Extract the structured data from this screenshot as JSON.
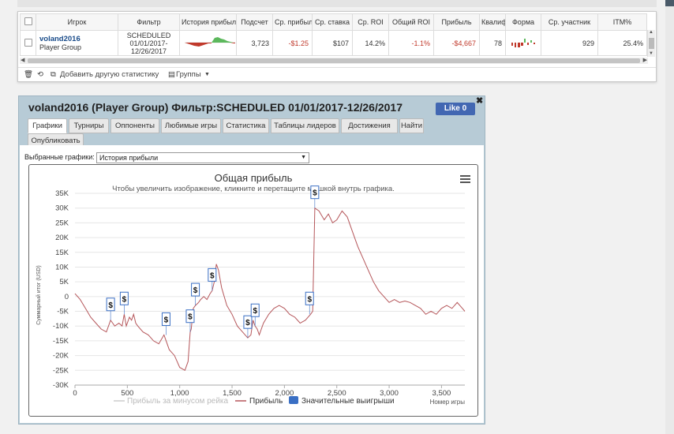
{
  "stats": {
    "columns": [
      "Игрок",
      "Фильтр",
      "История прибыли",
      "Подсчет",
      "Ср. прибыль",
      "Ср. ставка",
      "Ср. ROI",
      "Общий ROI",
      "Прибыль",
      "Квалиф.",
      "Форма",
      "Ср. участник",
      "ITM%"
    ],
    "row": {
      "player_name": "voland2016",
      "player_group": "Player Group",
      "filter_line1": "SCHEDULED",
      "filter_line2": "01/01/2017-",
      "filter_line3": "12/26/2017",
      "count": "3,723",
      "avg_profit": "-$1.25",
      "avg_stake": "$107",
      "avg_roi": "14.2%",
      "total_roi": "-1.1%",
      "profit": "-$4,667",
      "qualif": "78",
      "avg_entrants": "929",
      "itm": "25.4%"
    },
    "toolbar": {
      "add_stat": "Добавить другую статистику",
      "groups": "Группы"
    }
  },
  "panel": {
    "title": "voland2016 (Player Group) Фильтр:SCHEDULED 01/01/2017-12/26/2017",
    "like": "Like 0",
    "tabs": [
      "Графики",
      "Турниры",
      "Оппоненты",
      "Любимые игры",
      "Статистика",
      "Таблицы лидеров",
      "Достижения",
      "Найти",
      "Опубликовать"
    ],
    "selected_label": "Выбранные графики:",
    "selected_value": "История прибыли"
  },
  "chart_data": {
    "type": "line",
    "title": "Общая прибыль",
    "subtitle": "Чтобы увеличить изображение, кликните и перетащите мышкой внутрь графика.",
    "ylabel": "Суммарный итог (USD)",
    "xlabel": "Номер игры",
    "xlim": [
      0,
      3723
    ],
    "ylim": [
      -30000,
      35000
    ],
    "xticks": [
      0,
      500,
      1000,
      1500,
      2000,
      2500,
      3000,
      3500
    ],
    "xtick_labels": [
      "0",
      "500",
      "1,000",
      "1,500",
      "2,000",
      "2,500",
      "3,000",
      "3,500"
    ],
    "yticks": [
      35000,
      30000,
      25000,
      20000,
      15000,
      10000,
      5000,
      0,
      -5000,
      -10000,
      -15000,
      -20000,
      -25000,
      -30000
    ],
    "ytick_labels": [
      "35K",
      "30K",
      "25K",
      "20K",
      "15K",
      "10K",
      "5K",
      "0",
      "-5K",
      "-10K",
      "-15K",
      "-20K",
      "-25K",
      "-30K"
    ],
    "grid": "horizontal",
    "legend": [
      "Прибыль за минусом рейка",
      "Прибыль",
      "Значительные выигрыши"
    ],
    "legend_position": "bottom",
    "series": [
      {
        "name": "Прибыль",
        "color": "#b5565a",
        "points": [
          [
            0,
            1000
          ],
          [
            50,
            -1000
          ],
          [
            100,
            -4000
          ],
          [
            150,
            -7000
          ],
          [
            200,
            -9000
          ],
          [
            250,
            -11000
          ],
          [
            300,
            -12000
          ],
          [
            340,
            -8000
          ],
          [
            360,
            -9000
          ],
          [
            380,
            -10000
          ],
          [
            420,
            -9000
          ],
          [
            450,
            -10000
          ],
          [
            470,
            -6000
          ],
          [
            490,
            -10000
          ],
          [
            520,
            -7000
          ],
          [
            540,
            -8000
          ],
          [
            560,
            -6000
          ],
          [
            580,
            -9000
          ],
          [
            600,
            -10000
          ],
          [
            650,
            -12000
          ],
          [
            700,
            -13000
          ],
          [
            750,
            -15000
          ],
          [
            800,
            -16000
          ],
          [
            850,
            -13000
          ],
          [
            880,
            -16000
          ],
          [
            900,
            -18000
          ],
          [
            950,
            -20000
          ],
          [
            1000,
            -24000
          ],
          [
            1050,
            -25000
          ],
          [
            1080,
            -22000
          ],
          [
            1100,
            -12000
          ],
          [
            1110,
            -11000
          ],
          [
            1130,
            -4000
          ],
          [
            1150,
            -3000
          ],
          [
            1180,
            -2000
          ],
          [
            1200,
            -1000
          ],
          [
            1230,
            0
          ],
          [
            1260,
            -1000
          ],
          [
            1290,
            1000
          ],
          [
            1310,
            2000
          ],
          [
            1330,
            5000
          ],
          [
            1350,
            11000
          ],
          [
            1370,
            9000
          ],
          [
            1400,
            3000
          ],
          [
            1450,
            -3000
          ],
          [
            1500,
            -6000
          ],
          [
            1550,
            -10000
          ],
          [
            1600,
            -12000
          ],
          [
            1650,
            -14000
          ],
          [
            1680,
            -13000
          ],
          [
            1700,
            -8000
          ],
          [
            1720,
            -10000
          ],
          [
            1740,
            -11000
          ],
          [
            1760,
            -13000
          ],
          [
            1800,
            -9000
          ],
          [
            1850,
            -6000
          ],
          [
            1900,
            -4000
          ],
          [
            1950,
            -3000
          ],
          [
            2000,
            -4000
          ],
          [
            2050,
            -6000
          ],
          [
            2100,
            -7000
          ],
          [
            2150,
            -9000
          ],
          [
            2200,
            -8000
          ],
          [
            2250,
            -6000
          ],
          [
            2270,
            -5000
          ],
          [
            2290,
            30000
          ],
          [
            2330,
            29000
          ],
          [
            2380,
            26000
          ],
          [
            2420,
            28000
          ],
          [
            2460,
            25000
          ],
          [
            2500,
            26000
          ],
          [
            2550,
            29000
          ],
          [
            2600,
            27000
          ],
          [
            2650,
            22000
          ],
          [
            2700,
            17000
          ],
          [
            2750,
            13000
          ],
          [
            2800,
            9000
          ],
          [
            2850,
            5000
          ],
          [
            2900,
            2000
          ],
          [
            2950,
            0
          ],
          [
            3000,
            -2000
          ],
          [
            3050,
            -1000
          ],
          [
            3100,
            -2000
          ],
          [
            3150,
            -1500
          ],
          [
            3200,
            -2000
          ],
          [
            3250,
            -3000
          ],
          [
            3300,
            -4000
          ],
          [
            3350,
            -6000
          ],
          [
            3400,
            -5000
          ],
          [
            3450,
            -6000
          ],
          [
            3500,
            -4000
          ],
          [
            3550,
            -3000
          ],
          [
            3600,
            -4000
          ],
          [
            3650,
            -2000
          ],
          [
            3700,
            -4000
          ],
          [
            3723,
            -5000
          ]
        ]
      }
    ],
    "big_wins": [
      [
        340,
        -8000
      ],
      [
        470,
        -6000
      ],
      [
        870,
        -13000
      ],
      [
        1100,
        -12000
      ],
      [
        1150,
        -3000
      ],
      [
        1310,
        2000
      ],
      [
        1650,
        -14000
      ],
      [
        1720,
        -10000
      ],
      [
        2240,
        -6000
      ],
      [
        2290,
        30000
      ]
    ]
  }
}
